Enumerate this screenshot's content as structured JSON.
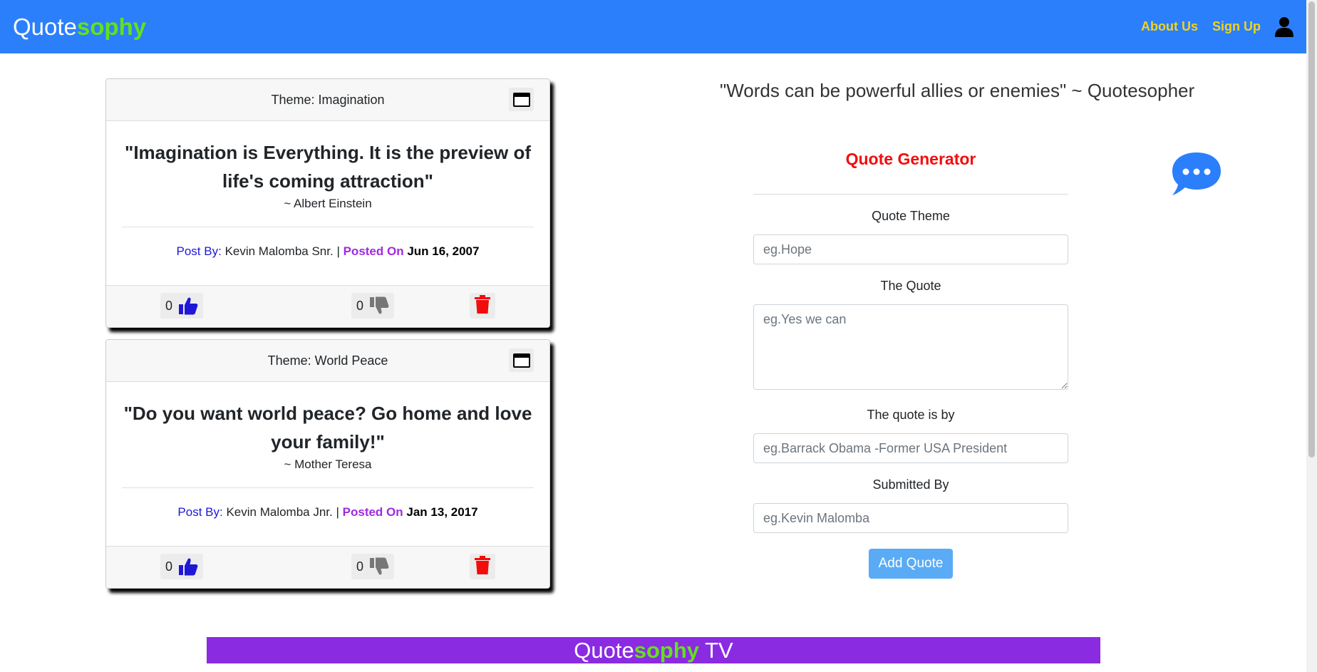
{
  "nav": {
    "brand_plain": "Quote",
    "brand_accent": "sophy",
    "about_label": "About Us",
    "signup_label": "Sign Up",
    "user_icon": "user-icon"
  },
  "quotes": [
    {
      "theme": "Theme: Imagination",
      "text": "\"Imagination is Everything. It is the preview of life's coming attraction\"",
      "author": "~ Albert Einstein",
      "post_by_label": "Post By:",
      "poster": "Kevin Malomba Snr.",
      "separator": "|",
      "posted_on_label": "Posted On",
      "date": "Jun 16, 2007",
      "upvotes": "0",
      "downvotes": "0"
    },
    {
      "theme": "Theme: World Peace",
      "text": "\"Do you want world peace? Go home and love your family!\"",
      "author": "~ Mother Teresa",
      "post_by_label": "Post By:",
      "poster": "Kevin Malomba Jnr.",
      "separator": "|",
      "posted_on_label": "Posted On",
      "date": "Jan 13, 2017",
      "upvotes": "0",
      "downvotes": "0"
    }
  ],
  "tagline": "\"Words can be powerful allies or enemies\" ~ Quotesopher",
  "form": {
    "title": "Quote Generator",
    "theme_label": "Quote Theme",
    "theme_placeholder": "eg.Hope",
    "quote_label": "The Quote",
    "quote_placeholder": "eg.Yes we can",
    "by_label": "The quote is by",
    "by_placeholder": "eg.Barrack Obama -Former USA President",
    "submitted_label": "Submitted By",
    "submitted_placeholder": "eg.Kevin Malomba",
    "submit_label": "Add Quote"
  },
  "footer": {
    "tv_plain": "Quote",
    "tv_accent": "sophy",
    "tv_suffix": " TV"
  },
  "colors": {
    "navbar": "#2b7ffb",
    "brand_accent": "#64e01d",
    "nav_link": "#f2d31c",
    "form_title": "#f20d0d",
    "post_by": "#1f17d6",
    "posted_on": "#9d2ae0",
    "tv_banner": "#8a2be2",
    "add_button": "#5aabf5"
  }
}
